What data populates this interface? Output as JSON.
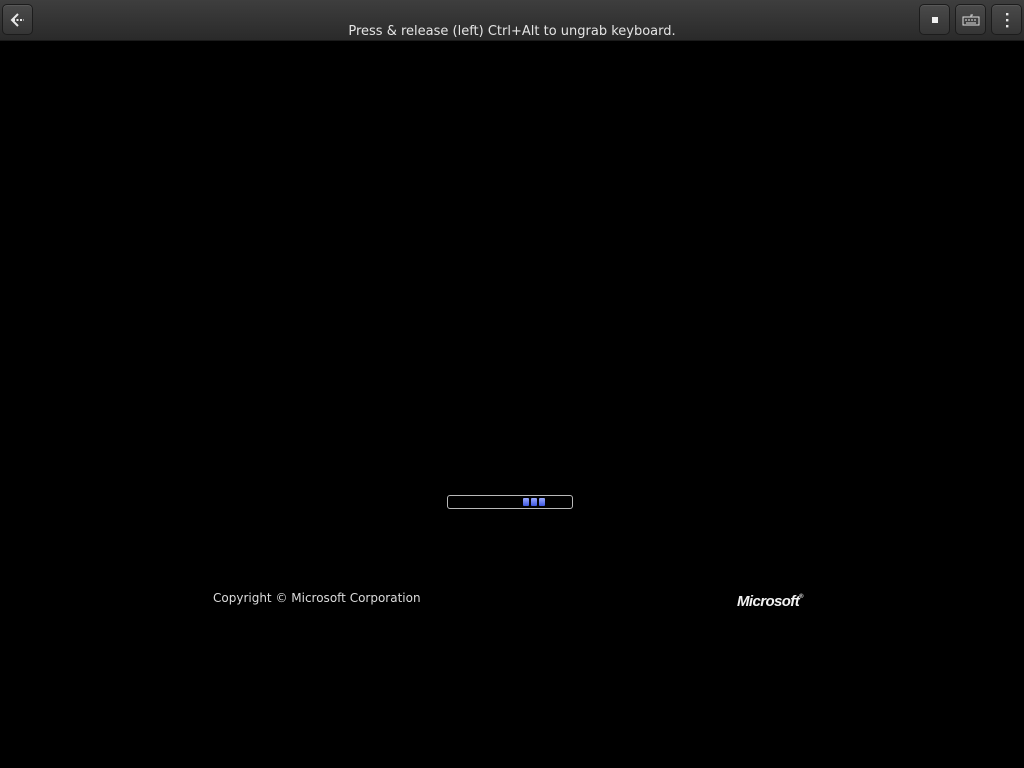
{
  "topbar": {
    "hint": "Press & release (left) Ctrl+Alt to ungrab keyboard.",
    "buttons": {
      "back_icon": "back-arrow-icon",
      "stop_icon": "stop-icon",
      "keyboard_icon": "keyboard-icon",
      "menu_icon": "more-vertical-icon"
    }
  },
  "boot_screen": {
    "copyright": "Copyright © Microsoft Corporation",
    "logo_text": "Microsoft",
    "logo_mark": "®",
    "progress_color": "#4a63f0",
    "background": "#000000"
  }
}
